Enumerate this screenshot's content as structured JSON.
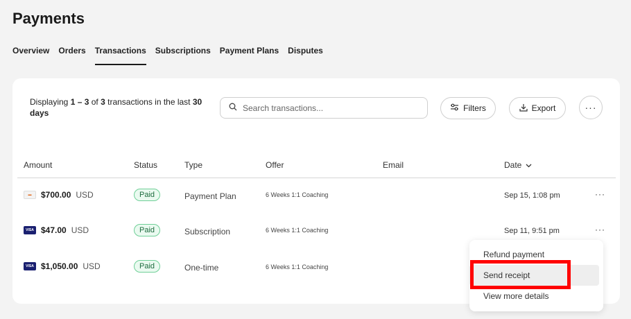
{
  "page": {
    "title": "Payments"
  },
  "tabs": [
    {
      "label": "Overview",
      "active": false
    },
    {
      "label": "Orders",
      "active": false
    },
    {
      "label": "Transactions",
      "active": true
    },
    {
      "label": "Subscriptions",
      "active": false
    },
    {
      "label": "Payment Plans",
      "active": false
    },
    {
      "label": "Disputes",
      "active": false
    }
  ],
  "summary": {
    "prefix": "Displaying ",
    "range": "1 – 3",
    "mid": " of ",
    "total": "3",
    "suffix": " transactions in the last ",
    "days": "30",
    "days_unit": "days"
  },
  "search": {
    "placeholder": "Search transactions...",
    "value": ""
  },
  "toolbar": {
    "filters_label": "Filters",
    "export_label": "Export",
    "more_label": "···"
  },
  "table": {
    "columns": [
      "Amount",
      "Status",
      "Type",
      "Offer",
      "Email",
      "Date"
    ],
    "sort_column": "Date",
    "rows": [
      {
        "card": "other",
        "amount": "$700.00",
        "currency": "USD",
        "status": "Paid",
        "type": "Payment Plan",
        "offer": "6 Weeks 1:1 Coaching",
        "email": "",
        "date": "Sep 15, 1:08 pm",
        "more": "···"
      },
      {
        "card": "visa",
        "amount": "$47.00",
        "currency": "USD",
        "status": "Paid",
        "type": "Subscription",
        "offer": "6 Weeks 1:1 Coaching",
        "email": "",
        "date": "Sep 11, 9:51 pm",
        "more": "···"
      },
      {
        "card": "visa",
        "amount": "$1,050.00",
        "currency": "USD",
        "status": "Paid",
        "type": "One-time",
        "offer": "6 Weeks 1:1 Coaching",
        "email": "",
        "date": "",
        "more": ""
      }
    ]
  },
  "menu": {
    "items": [
      "Refund payment",
      "Send receipt",
      "View more details"
    ]
  },
  "colors": {
    "accent": "#1a1a1a",
    "paid_bg": "#eafaf0",
    "paid_border": "#6fcf97",
    "highlight": "#ff0000"
  }
}
